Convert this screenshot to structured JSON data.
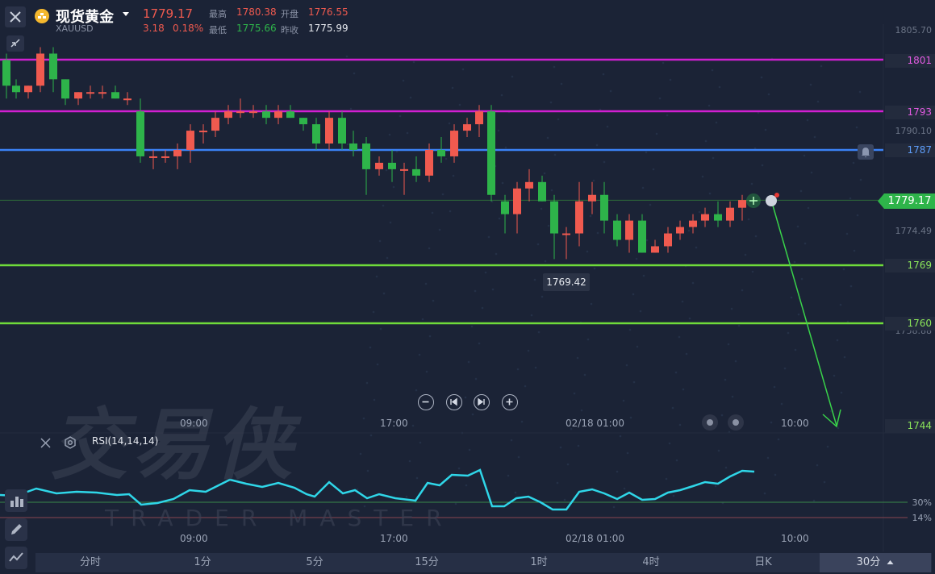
{
  "header": {
    "title": "现货黄金",
    "symbol": "XAUUSD",
    "price": "1779.17",
    "change": "3.18",
    "change_pct": "0.18%",
    "high_label": "最高",
    "high": "1780.38",
    "open_label": "开盘",
    "open": "1776.55",
    "low_label": "最低",
    "low": "1775.66",
    "prev_close_label": "昨收",
    "prev_close": "1775.99"
  },
  "colors": {
    "up": "#f05a4f",
    "down": "#2eb44a",
    "resistance": "#d11fd1",
    "pivot": "#3b82f6",
    "support": "#6fdc3a",
    "rsi": "#2fd6e8"
  },
  "price_axis": [
    "1805.70",
    "1790.10",
    "1774.49",
    "1758.88"
  ],
  "levels": [
    {
      "value": "1801",
      "color": "#d11fd1"
    },
    {
      "value": "1793",
      "color": "#d11fd1"
    },
    {
      "value": "1787",
      "color": "#3b82f6"
    },
    {
      "value": "1769",
      "color": "#6fdc3a"
    },
    {
      "value": "1760",
      "color": "#6fdc3a"
    },
    {
      "value": "1744",
      "color": "#6fdc3a"
    }
  ],
  "current_price_tag": "1779.17",
  "low_marker": "1769.42",
  "time_axis": [
    "09:00",
    "17:00",
    "02/18 01:00",
    "10:00"
  ],
  "watermark": {
    "cn": "交易侠",
    "en": "TRADER MASTER"
  },
  "rsi": {
    "label": "RSI(14,14,14)",
    "levels": [
      "30%",
      "14%"
    ]
  },
  "periods": [
    "分时",
    "1分",
    "5分",
    "15分",
    "1时",
    "4时",
    "日K",
    "30分"
  ],
  "active_period": "30分",
  "icons": [
    "close-icon",
    "shrink-icon",
    "zoom-out-icon",
    "prev-icon",
    "next-icon",
    "zoom-in-icon",
    "bell-icon",
    "pencil-icon",
    "indicator-icon",
    "settings-icon",
    "close-rsi-icon",
    "tools-icon"
  ]
}
